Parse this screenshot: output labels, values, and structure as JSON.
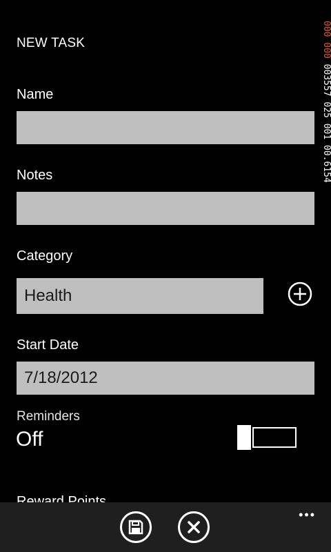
{
  "page": {
    "title": "NEW TASK"
  },
  "form": {
    "name": {
      "label": "Name",
      "value": ""
    },
    "notes": {
      "label": "Notes",
      "value": ""
    },
    "category": {
      "label": "Category",
      "value": "Health"
    },
    "start_date": {
      "label": "Start Date",
      "value": "7/18/2012"
    },
    "reminders": {
      "label": "Reminders",
      "state": "Off"
    },
    "reward_points": {
      "label": "Reward Points"
    }
  },
  "debug": {
    "counter_red": "000 000",
    "counter_white": "003557 025 001 00.6154"
  },
  "appbar": {
    "save_icon": "save-icon",
    "cancel_icon": "close-icon",
    "more": "•••"
  }
}
